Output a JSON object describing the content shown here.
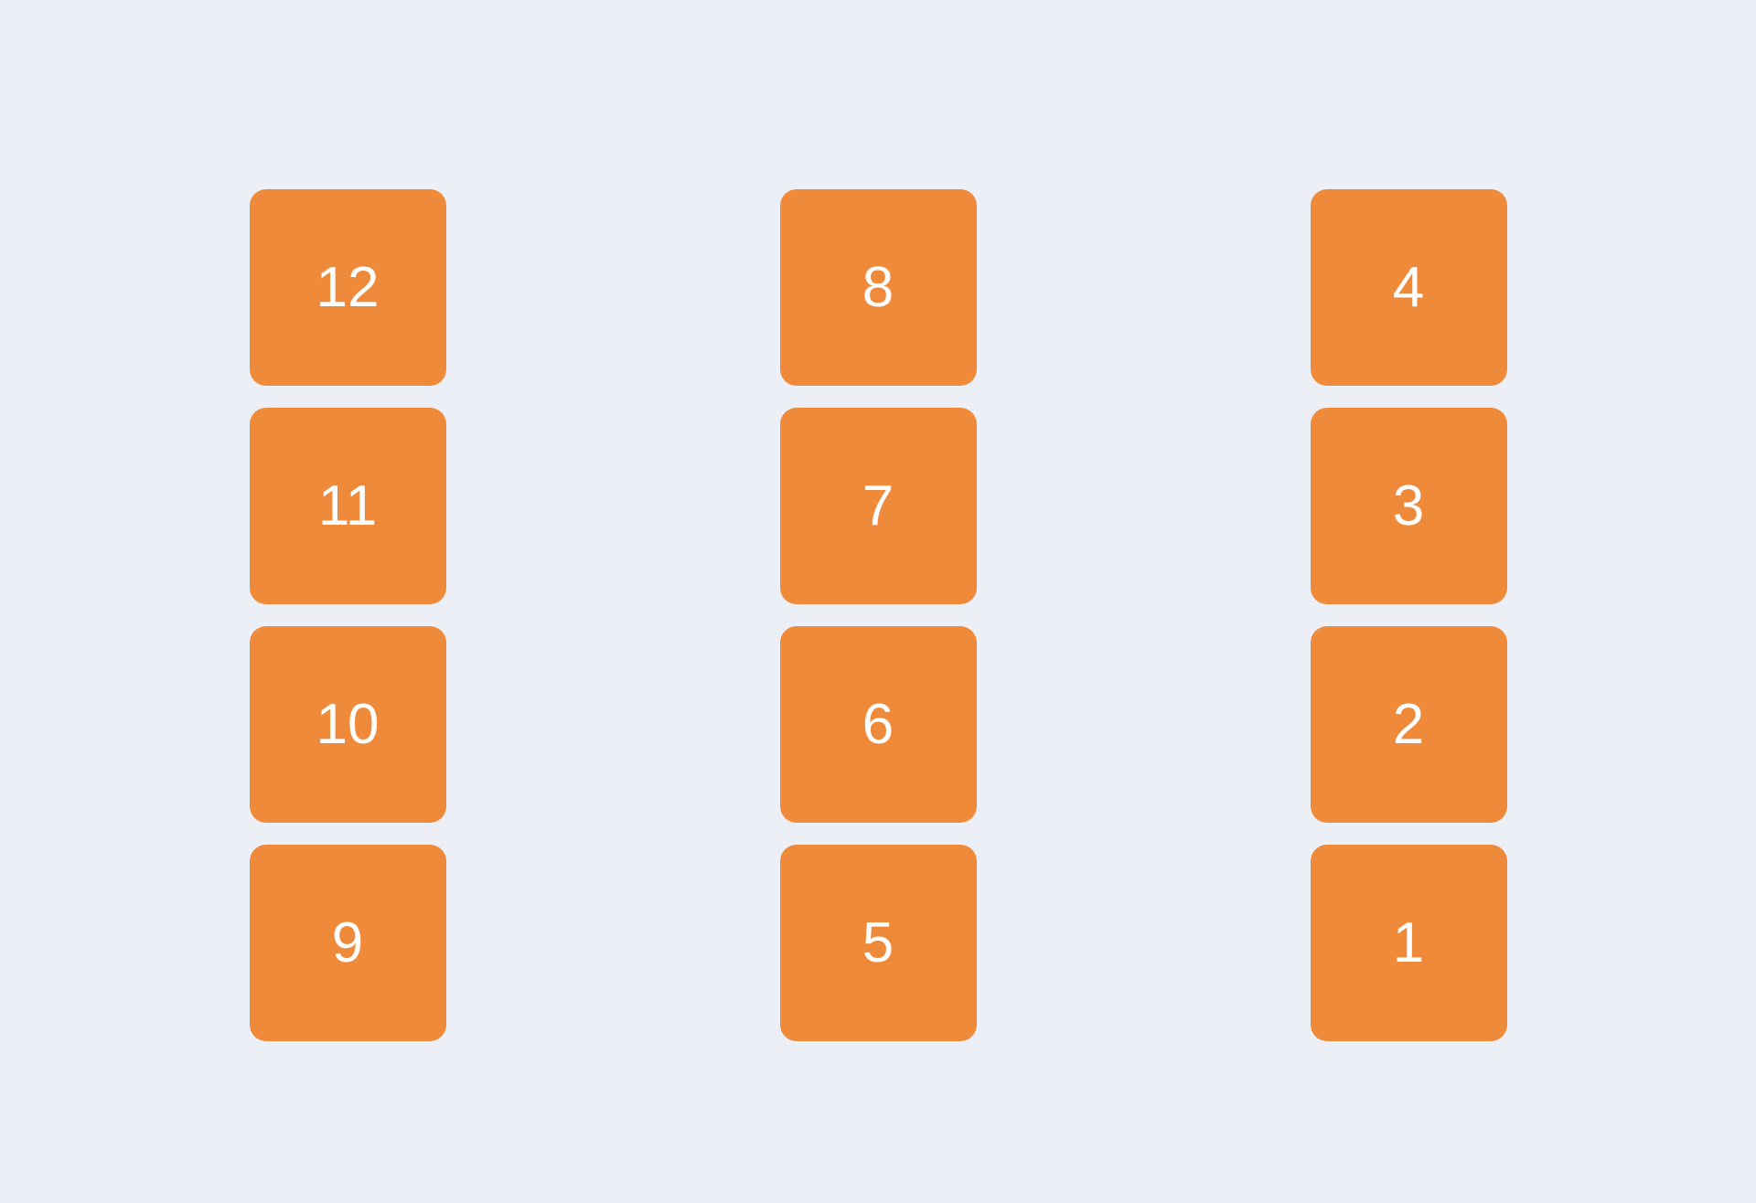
{
  "columns": [
    {
      "tiles": [
        "12",
        "11",
        "10",
        "9"
      ]
    },
    {
      "tiles": [
        "8",
        "7",
        "6",
        "5"
      ]
    },
    {
      "tiles": [
        "4",
        "3",
        "2",
        "1"
      ]
    }
  ],
  "colors": {
    "tile": "#ee8a3a",
    "background": "#eceff5",
    "text": "#ffffff"
  }
}
